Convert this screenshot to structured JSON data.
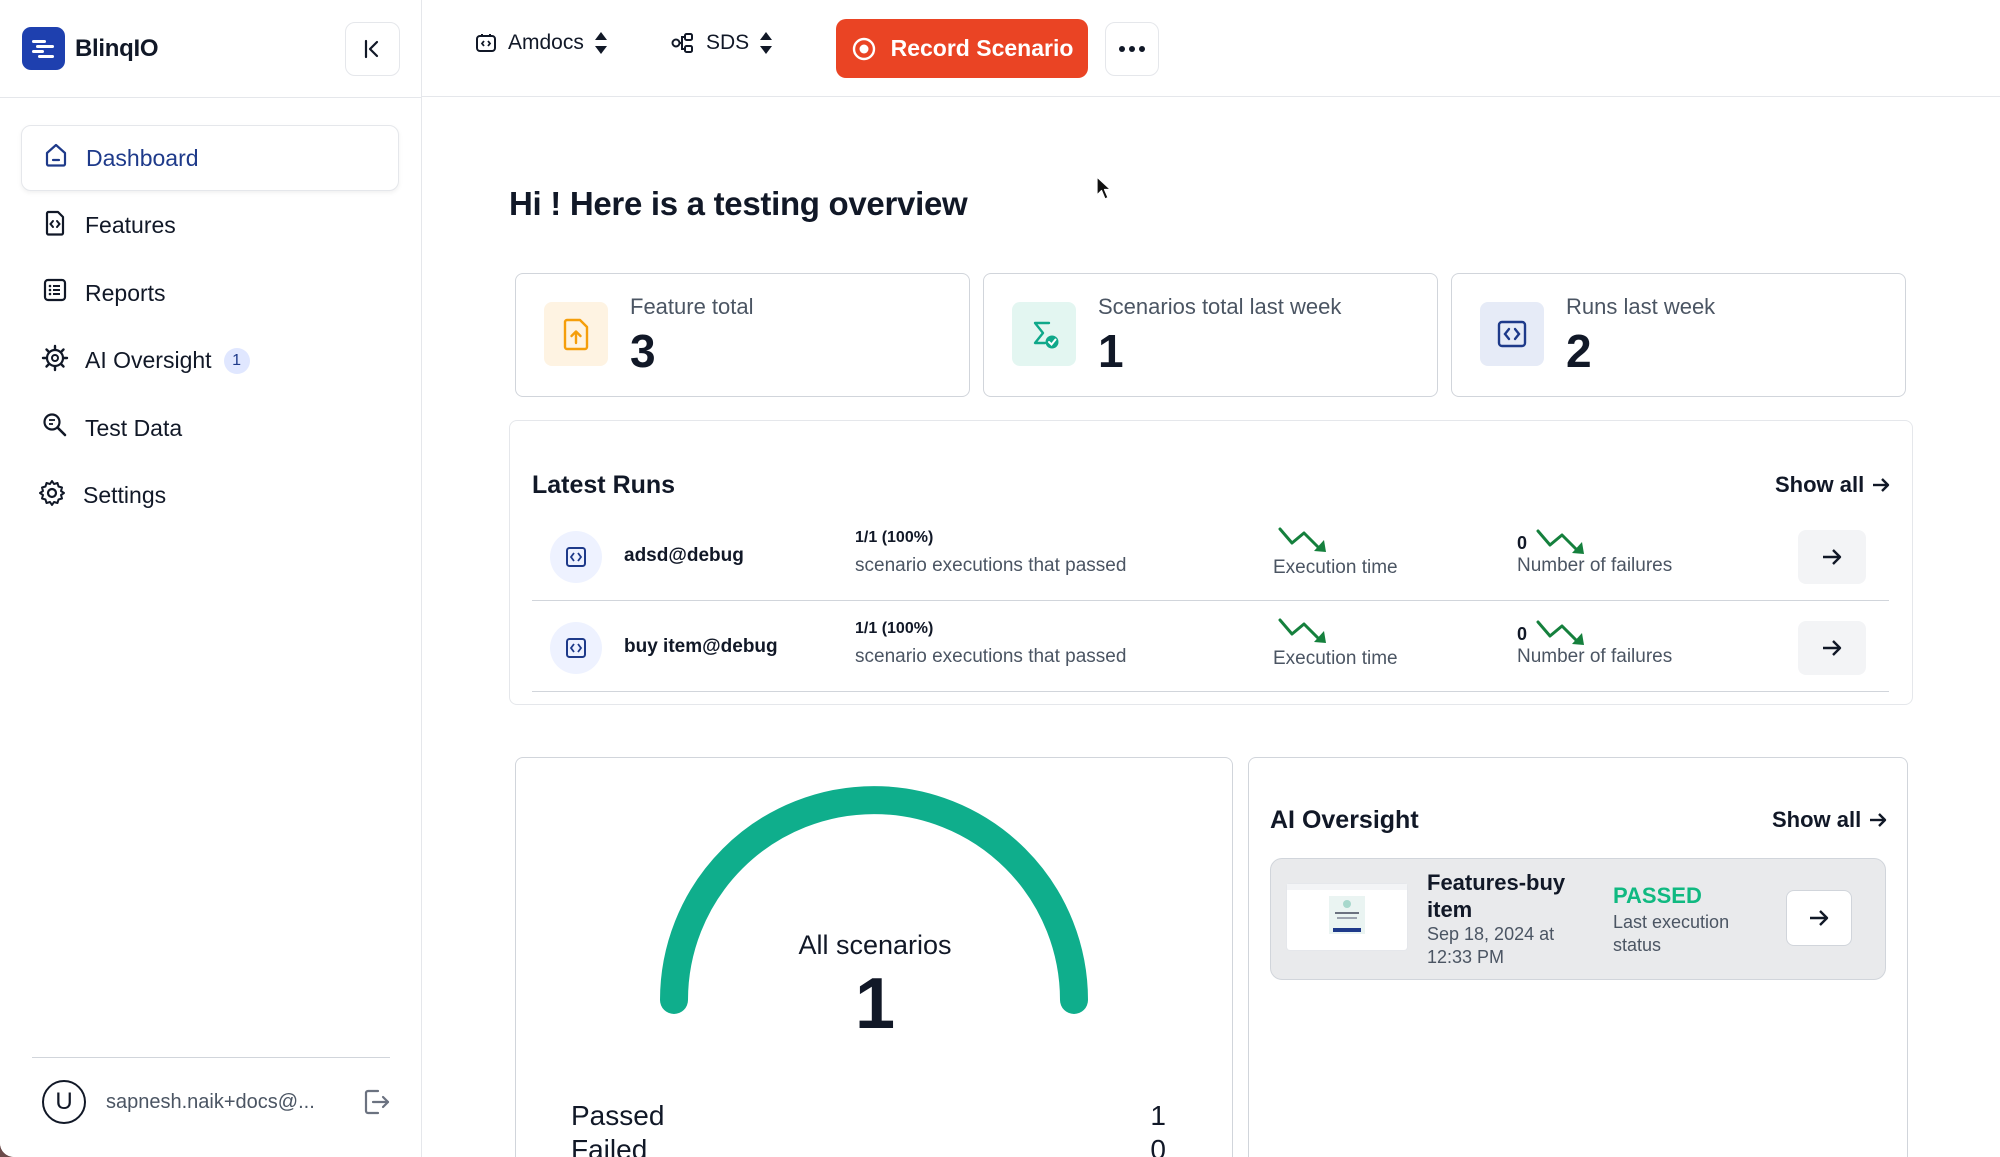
{
  "app": {
    "name": "BlinqIO"
  },
  "sidebar": {
    "items": [
      {
        "label": "Dashboard",
        "icon": "home-icon",
        "active": true
      },
      {
        "label": "Features",
        "icon": "feature-file-icon"
      },
      {
        "label": "Reports",
        "icon": "list-icon"
      },
      {
        "label": "AI Oversight",
        "icon": "ai-gear-icon",
        "badge": "1"
      },
      {
        "label": "Test Data",
        "icon": "search-data-icon"
      },
      {
        "label": "Settings",
        "icon": "gear-icon"
      }
    ],
    "user": {
      "initial": "U",
      "email": "sapnesh.naik+docs@..."
    }
  },
  "topbar": {
    "project": "Amdocs",
    "environment": "SDS",
    "record_label": "Record Scenario"
  },
  "main": {
    "greeting": "Hi ! Here is a testing overview",
    "stats": [
      {
        "label": "Feature total",
        "value": "3",
        "color": "#f59e0b"
      },
      {
        "label": "Scenarios total last week",
        "value": "1",
        "color": "#0fa88a"
      },
      {
        "label": "Runs last week",
        "value": "2",
        "color": "#1e3a8a"
      }
    ],
    "latest_runs": {
      "title": "Latest Runs",
      "show_all": "Show all",
      "rows": [
        {
          "name": "adsd@debug",
          "ratio": "1/1 (100%)",
          "ratio_label": "scenario executions that passed",
          "exec_label": "Execution time",
          "failures": "0",
          "failures_label": "Number of failures"
        },
        {
          "name": "buy item@debug",
          "ratio": "1/1 (100%)",
          "ratio_label": "scenario executions that passed",
          "exec_label": "Execution time",
          "failures": "0",
          "failures_label": "Number of failures"
        }
      ]
    },
    "scenarios_gauge": {
      "label": "All scenarios",
      "total": "1",
      "passed_label": "Passed",
      "passed": "1",
      "failed_label": "Failed",
      "failed": "0",
      "pass_fraction": 1.0,
      "color": "#0fae8c"
    },
    "ai_oversight": {
      "title": "AI Oversight",
      "show_all": "Show all",
      "item": {
        "title": "Features-buy item",
        "date": "Sep 18, 2024 at 12:33 PM",
        "status": "PASSED",
        "status_label": "Last execution status"
      }
    }
  },
  "colors": {
    "accent": "#1e40af",
    "record": "#ea4424",
    "success": "#10b981",
    "trend": "#15803d"
  }
}
